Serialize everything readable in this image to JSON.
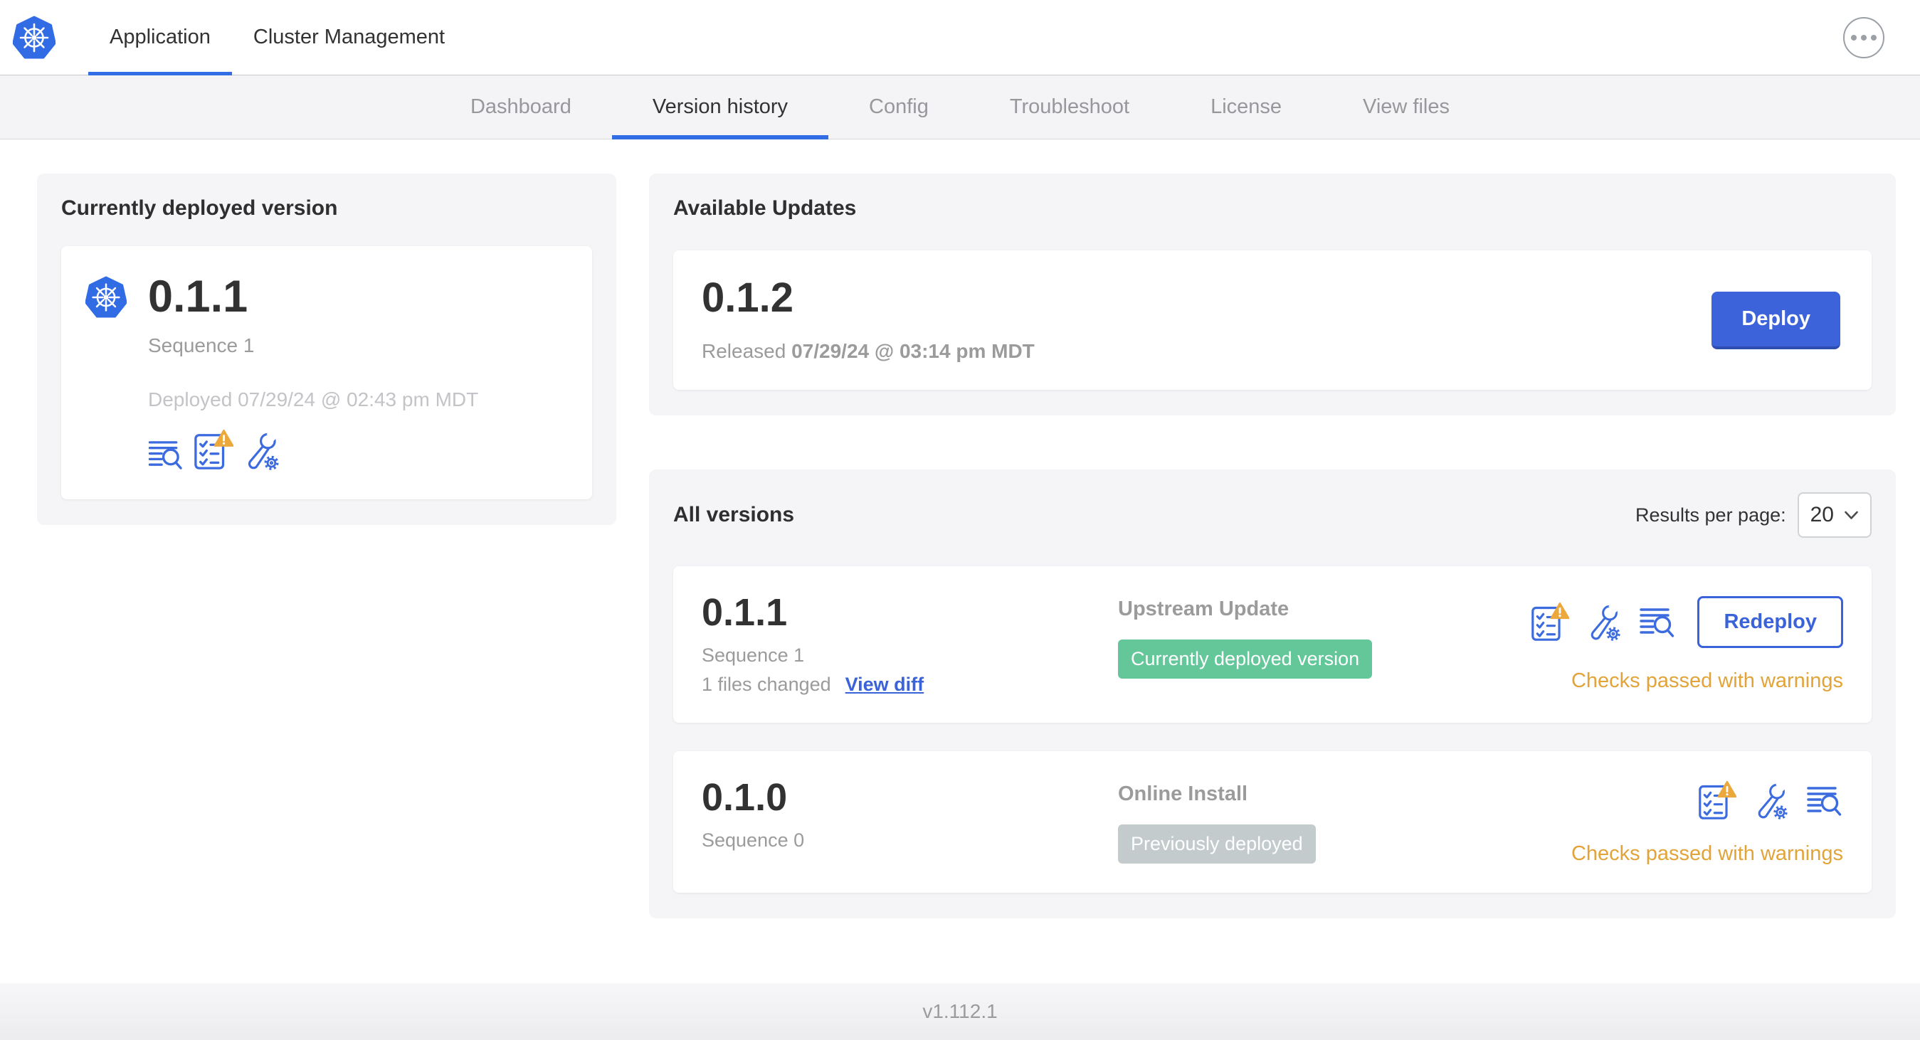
{
  "header": {
    "tabs": [
      {
        "label": "Application",
        "active": true
      },
      {
        "label": "Cluster Management",
        "active": false
      }
    ]
  },
  "subnav": {
    "tabs": [
      {
        "label": "Dashboard",
        "active": false
      },
      {
        "label": "Version history",
        "active": true
      },
      {
        "label": "Config",
        "active": false
      },
      {
        "label": "Troubleshoot",
        "active": false
      },
      {
        "label": "License",
        "active": false
      },
      {
        "label": "View files",
        "active": false
      }
    ]
  },
  "currently_deployed": {
    "title": "Currently deployed version",
    "version": "0.1.1",
    "sequence": "Sequence 1",
    "deployed_at": "Deployed 07/29/24 @ 02:43 pm MDT",
    "icons": [
      "view-logs-icon",
      "preflight-checks-warning-icon",
      "edit-config-icon"
    ]
  },
  "available_updates": {
    "title": "Available Updates",
    "version": "0.1.2",
    "released_label": "Released",
    "released_at": "07/29/24 @ 03:14 pm MDT",
    "deploy_label": "Deploy"
  },
  "all_versions": {
    "title": "All versions",
    "results_per_page_label": "Results per page:",
    "results_per_page_value": "20",
    "rows": [
      {
        "version": "0.1.1",
        "sequence": "Sequence 1",
        "files_changed": "1 files changed",
        "view_diff_label": "View diff",
        "source": "Upstream Update",
        "badge": {
          "label": "Currently deployed version",
          "color": "#63c79a"
        },
        "icons": [
          "preflight-checks-warning-icon",
          "edit-config-icon",
          "view-logs-icon"
        ],
        "action_label": "Redeploy",
        "status": "Checks passed with warnings"
      },
      {
        "version": "0.1.0",
        "sequence": "Sequence 0",
        "source": "Online Install",
        "badge": {
          "label": "Previously deployed",
          "color": "#c3cbcc"
        },
        "icons": [
          "preflight-checks-warning-icon",
          "edit-config-icon",
          "view-logs-icon"
        ],
        "status": "Checks passed with warnings"
      }
    ]
  },
  "footer": {
    "version": "v1.112.1"
  },
  "colors": {
    "accent_blue": "#3a62d9",
    "kubernetes_blue": "#326ce5",
    "active_tab_underline": "#326de6",
    "warning_orange": "#e2a339",
    "badge_green": "#63c79a",
    "badge_gray": "#c3cbcc"
  }
}
